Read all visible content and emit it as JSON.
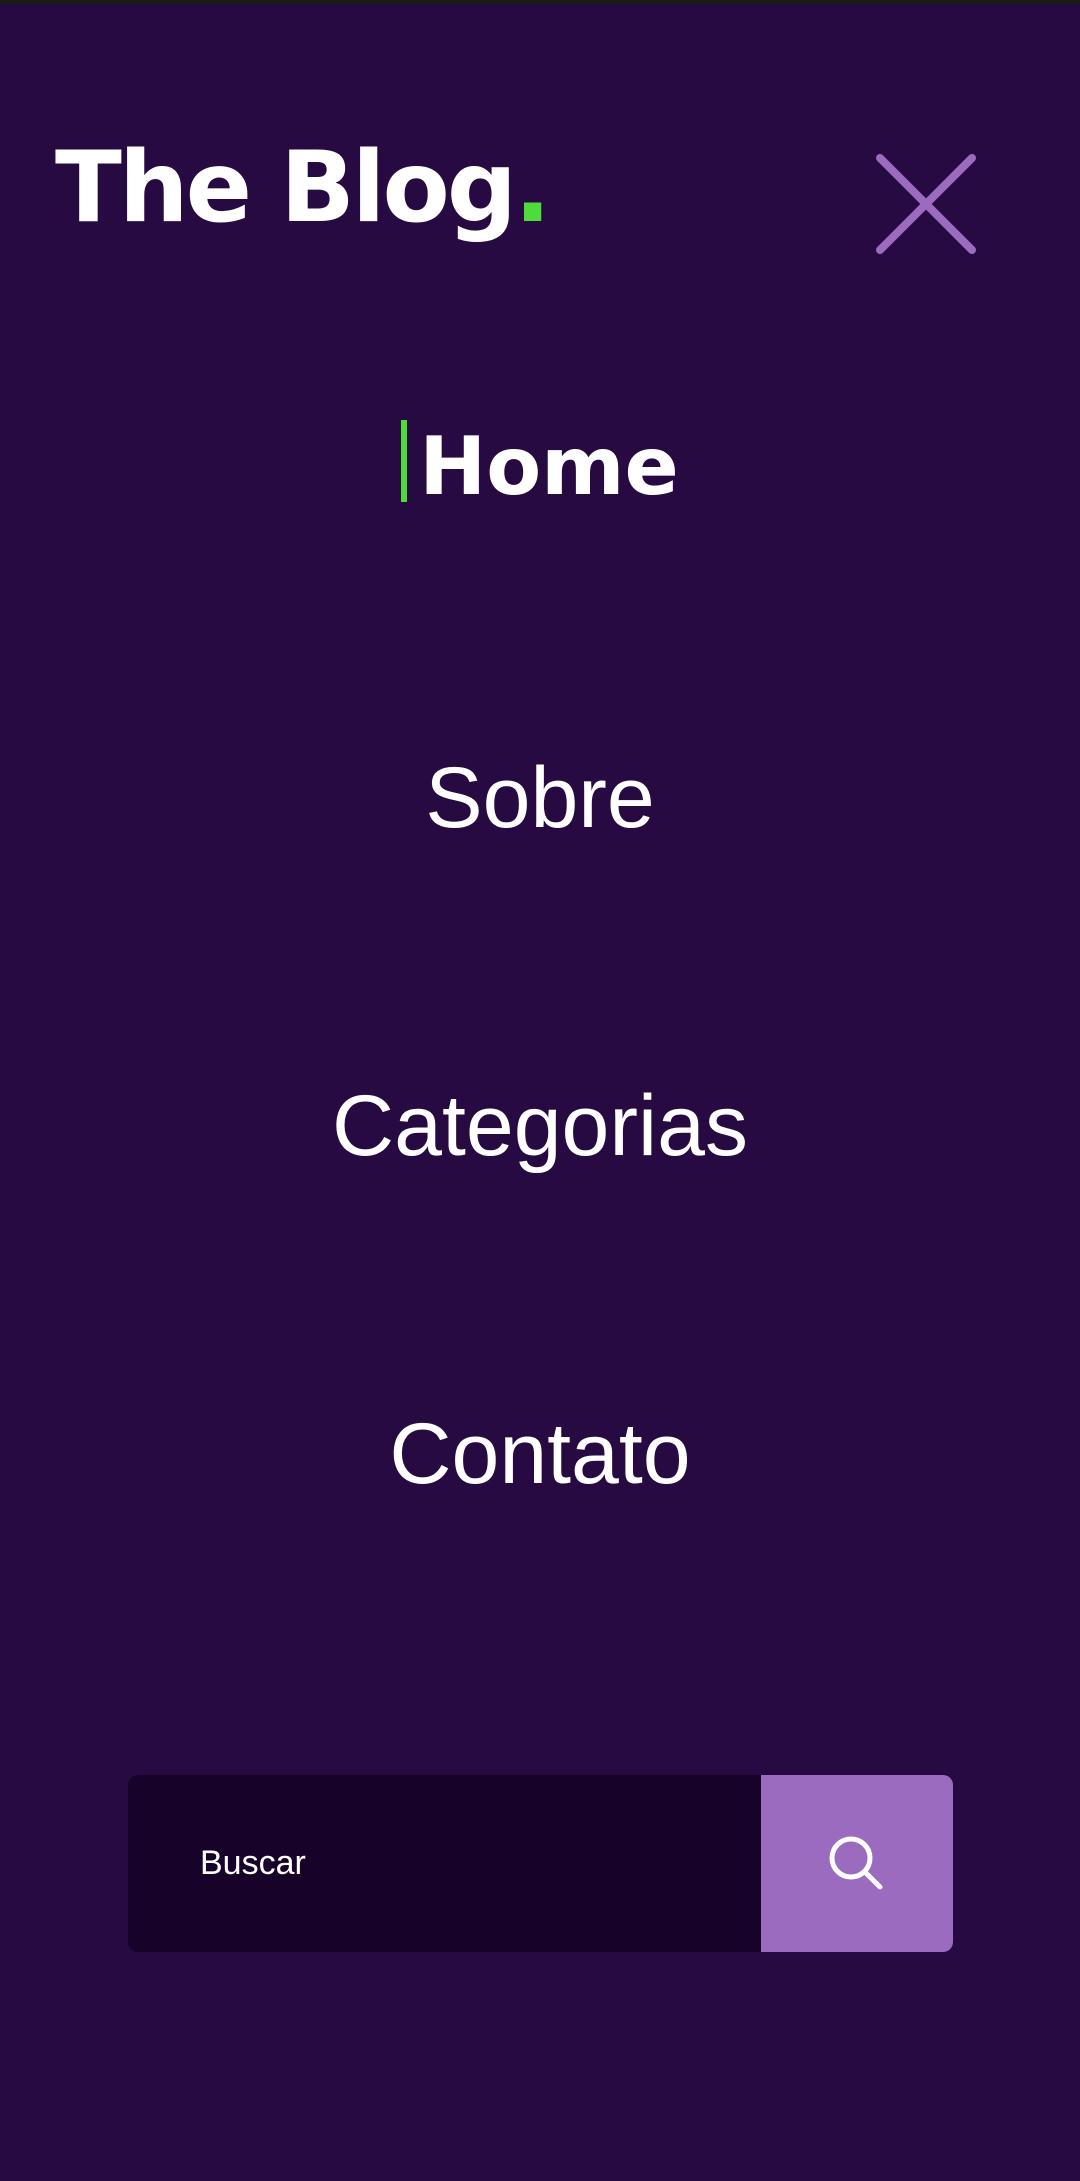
{
  "brand": {
    "name": "The Blog",
    "dot": ".",
    "accent_color": "#4ddc3a"
  },
  "header": {
    "close_icon": "close-icon"
  },
  "nav": {
    "items": [
      {
        "label": "Home",
        "active": true
      },
      {
        "label": "Sobre",
        "active": false
      },
      {
        "label": "Categorias",
        "active": false
      },
      {
        "label": "Contato",
        "active": false
      }
    ]
  },
  "search": {
    "placeholder": "Buscar",
    "button_icon": "search-icon"
  },
  "colors": {
    "background": "#280a43",
    "input_background": "#17022a",
    "button_background": "#9a6bbf",
    "close_icon": "#9a6bbf",
    "text": "#ffffff"
  }
}
